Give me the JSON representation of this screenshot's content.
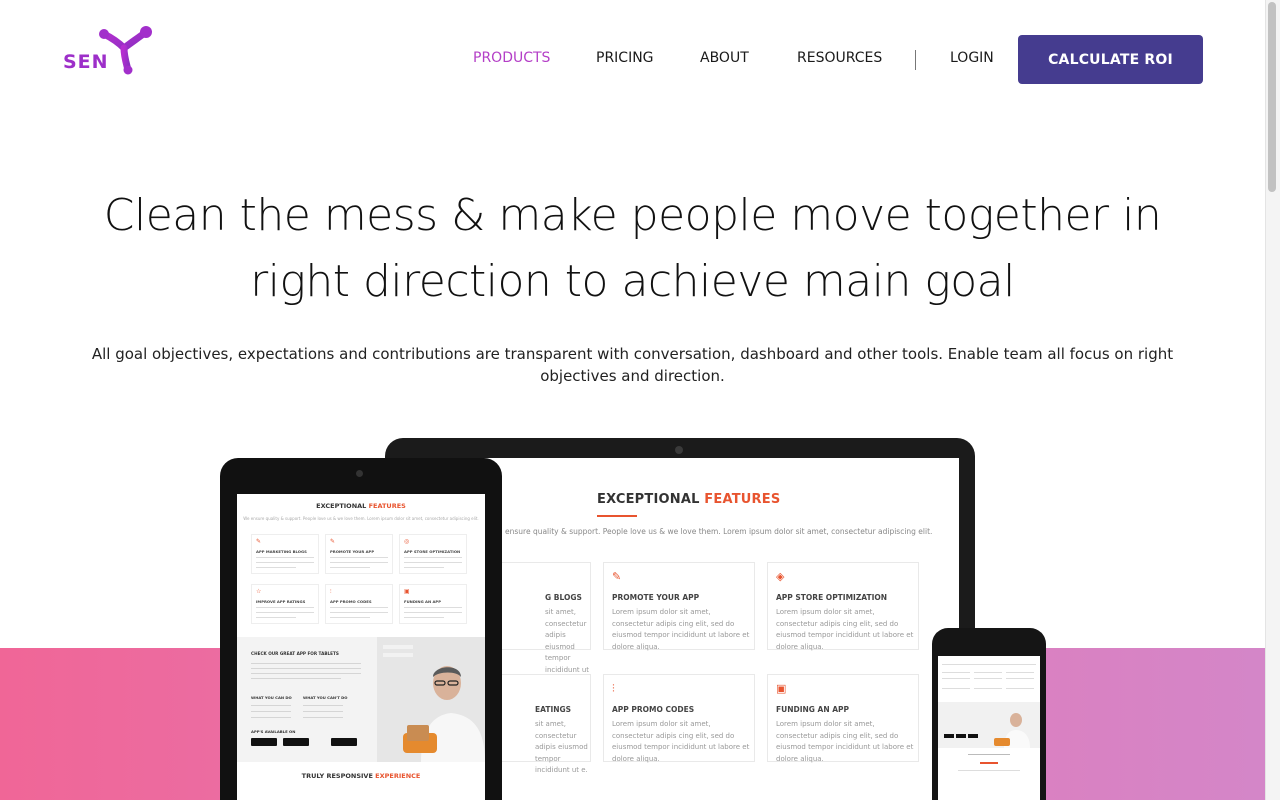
{
  "brand": {
    "logo_text": "SEN",
    "logo_color": "#9d2fc9"
  },
  "nav": {
    "items": [
      {
        "label": "PRODUCTS",
        "active": true
      },
      {
        "label": "PRICING",
        "active": false
      },
      {
        "label": "ABOUT",
        "active": false
      },
      {
        "label": "RESOURCES",
        "active": false
      }
    ],
    "login_label": "LOGIN",
    "cta_label": "CALCULATE ROI",
    "active_color": "#b43fc7",
    "cta_color": "#453c8f"
  },
  "hero": {
    "title_line1": "Clean the mess & make people move together in",
    "title_line2": "right direction to achieve main goal",
    "subtitle": "All goal objectives, expectations and contributions are transparent with conversation, dashboard and other tools. Enable team all focus on right objectives and direction."
  },
  "laptop_screen": {
    "title_plain": "EXCEPTIONAL ",
    "title_highlight": "FEATURES",
    "subtitle": "ensure quality & support. People love us & we love them. Lorem ipsum dolor sit amet, consectetur adipiscing elit.",
    "cards": [
      {
        "title": "G BLOGS",
        "text": "sit amet, consectetur adipis eiusmod tempor incididunt ut e."
      },
      {
        "title": "PROMOTE YOUR APP",
        "text": "Lorem ipsum dolor sit amet, consectetur adipis cing elit, sed do eiusmod tempor incididunt ut labore et dolore aliqua."
      },
      {
        "title": "APP STORE OPTIMIZATION",
        "text": "Lorem ipsum dolor sit amet, consectetur adipis cing elit, sed do eiusmod tempor incididunt ut labore et dolore aliqua."
      },
      {
        "title": "EATINGS",
        "text": "sit amet, consectetur adipis eiusmod tempor incididunt ut e."
      },
      {
        "title": "APP PROMO CODES",
        "text": "Lorem ipsum dolor sit amet, consectetur adipis cing elit, sed do eiusmod tempor incididunt ut labore et dolore aliqua."
      },
      {
        "title": "FUNDING AN APP",
        "text": "Lorem ipsum dolor sit amet, consectetur adipis cing elit, sed do eiusmod tempor incididunt ut labore et dolore aliqua."
      }
    ]
  },
  "tablet_screen": {
    "title_plain": "EXCEPTIONAL ",
    "title_highlight": "FEATURES",
    "subtitle": "We ensure quality & support. People love us & we love them. Lorem ipsum dolor sit amet, consectetur adipiscing elit.",
    "cards": [
      {
        "title": "APP MARKETING BLOGS"
      },
      {
        "title": "PROMOTE YOUR APP"
      },
      {
        "title": "APP STORE OPTIMIZATION"
      },
      {
        "title": "IMPROVE APP RATINGS"
      },
      {
        "title": "APP PROMO CODES"
      },
      {
        "title": "FUNDING AN APP"
      }
    ],
    "promo_title": "CHECK OUR GREAT APP FOR TABLETS",
    "promo_can": "WHAT YOU CAN DO",
    "promo_cant": "WHAT YOU CAN'T DO",
    "promo_available": "APP'S AVAILABLE ON",
    "bottom_plain": "TRULY RESPONSIVE ",
    "bottom_highlight": "EXPERIENCE"
  },
  "accent_color": "#e8542f"
}
